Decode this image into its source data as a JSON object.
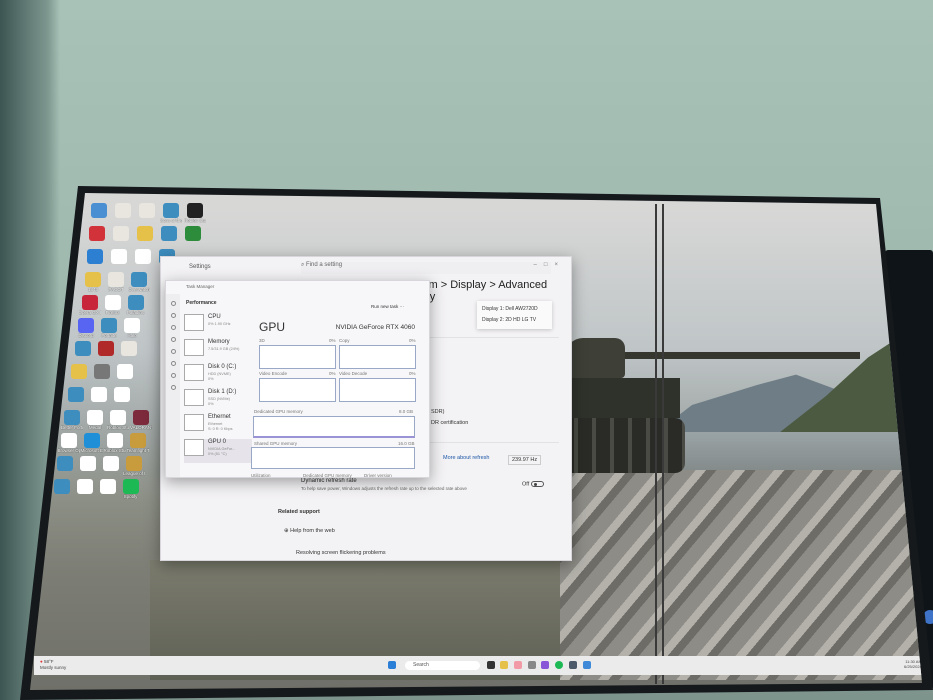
{
  "desktop": {
    "icons": [
      {
        "label": "",
        "color": "#4a8fd1"
      },
      {
        "label": "",
        "color": "#e9e6df"
      },
      {
        "label": "",
        "color": "#e9e6df"
      },
      {
        "label": "Sons of the Forest",
        "color": "#3d8dbf"
      },
      {
        "label": "Roblox Studio",
        "color": "#222"
      },
      {
        "label": "",
        "color": "#d2333a"
      },
      {
        "label": "",
        "color": "#e9e6df"
      },
      {
        "label": "",
        "color": "#e6c14a"
      },
      {
        "label": "",
        "color": "#3d8dbf"
      },
      {
        "label": "",
        "color": "#2c8c3b"
      },
      {
        "label": "",
        "color": "#2c7fd1"
      },
      {
        "label": "",
        "color": "#fff"
      },
      {
        "label": "",
        "color": "#fff"
      },
      {
        "label": "",
        "color": "#3d8dbf"
      },
      {
        "label": "1843",
        "color": "#e6c14a"
      },
      {
        "label": "PACOT",
        "color": "#e9e6df"
      },
      {
        "label": "Overwatch",
        "color": "#3d8dbf"
      },
      {
        "label": "Opera GX Browser",
        "color": "#c8263b"
      },
      {
        "label": "Firefox",
        "color": "#fff"
      },
      {
        "label": "Paladins",
        "color": "#3d8dbf"
      },
      {
        "label": "Discord",
        "color": "#5865f2"
      },
      {
        "label": "Fortnite",
        "color": "#3d8dbf"
      },
      {
        "label": "Halo",
        "color": "#fff"
      },
      {
        "label": "",
        "color": "#3d8dbf"
      },
      {
        "label": "",
        "color": "#b02a2a"
      },
      {
        "label": "",
        "color": "#e9e6df"
      },
      {
        "label": "",
        "color": "#e6c14a"
      },
      {
        "label": "",
        "color": "#777"
      },
      {
        "label": "",
        "color": "#fff"
      },
      {
        "label": "",
        "color": "#3d8dbf"
      },
      {
        "label": "",
        "color": "#fff"
      },
      {
        "label": "",
        "color": "#fff"
      },
      {
        "label": "Better Fortress",
        "color": "#3d8dbf"
      },
      {
        "label": "Medal",
        "color": "#fff"
      },
      {
        "label": "Roblox Studio",
        "color": "#fff"
      },
      {
        "label": "VALORANT",
        "color": "#7c2a3c"
      },
      {
        "label": "Browser Opera",
        "color": "#fff"
      },
      {
        "label": "Microsoft Edge",
        "color": "#1f8fd8"
      },
      {
        "label": "Roblox Studio",
        "color": "#fff"
      },
      {
        "label": "Teamfight Tactics",
        "color": "#c89b3c"
      },
      {
        "label": "",
        "color": "#3d8dbf"
      },
      {
        "label": "",
        "color": "#fff"
      },
      {
        "label": "",
        "color": "#fff"
      },
      {
        "label": "League of Legends",
        "color": "#c89b3c"
      },
      {
        "label": "",
        "color": "#3d8dbf"
      },
      {
        "label": "",
        "color": "#fff"
      },
      {
        "label": "",
        "color": "#fff"
      },
      {
        "label": "Spotify",
        "color": "#1db954"
      }
    ]
  },
  "settings": {
    "title": "Settings",
    "search_placeholder": "Find a setting",
    "heading": "System > Display > Advanced display",
    "display_options": [
      "Display 1: Dell AW2720D",
      "Display 2: 2D HD LG TV"
    ],
    "sdr": "SDR)",
    "hdr_cert": "DR certification",
    "more_refresh": "More about refresh",
    "refresh_rate": "239.97 Hz",
    "dynamic_title": "Dynamic refresh rate",
    "dynamic_desc": "To help save power, Windows adjusts the refresh rate up to the selected rate above",
    "dynamic_state": "Off",
    "related": "Related support",
    "help_web": "Help from the web",
    "flicker": "Resolving screen flickering problems"
  },
  "taskmgr": {
    "title": "Task Manager",
    "section": "Performance",
    "run_task": "Run new task",
    "resources": [
      {
        "name": "CPU",
        "sub": "0% 1.90 GHz"
      },
      {
        "name": "Memory",
        "sub": "7.5/31.9 GB (24%)"
      },
      {
        "name": "Disk 0 (C:)",
        "sub": "HDD (NVME)\n0%"
      },
      {
        "name": "Disk 1 (D:)",
        "sub": "SSD (NVMe)\n0%"
      },
      {
        "name": "Ethernet",
        "sub": "Ethernet\nS: 0 R: 0 Kbps"
      },
      {
        "name": "GPU 0",
        "sub": "NVIDIA GeFor...\n0% (51 °C)"
      }
    ],
    "gpu_title": "GPU",
    "gpu_name": "NVIDIA GeForce RTX 4060",
    "graphs": [
      {
        "label": "3D",
        "pct": "0%"
      },
      {
        "label": "Copy",
        "pct": "0%"
      },
      {
        "label": "Video Encode",
        "pct": "0%"
      },
      {
        "label": "Video Decode",
        "pct": "0%"
      }
    ],
    "dedicated_label": "Dedicated GPU memory",
    "dedicated_max": "8.0 GB",
    "shared_label": "Shared GPU memory",
    "shared_max": "16.0 GB",
    "footer_util": "Utilization",
    "footer_ded": "Dedicated GPU memory",
    "footer_driver": "Driver version"
  },
  "taskbar": {
    "weather_temp": "58°F",
    "weather_desc": "Mostly sunny",
    "search": "Search",
    "time": "11:30 AM",
    "date": "6/25/2024"
  }
}
